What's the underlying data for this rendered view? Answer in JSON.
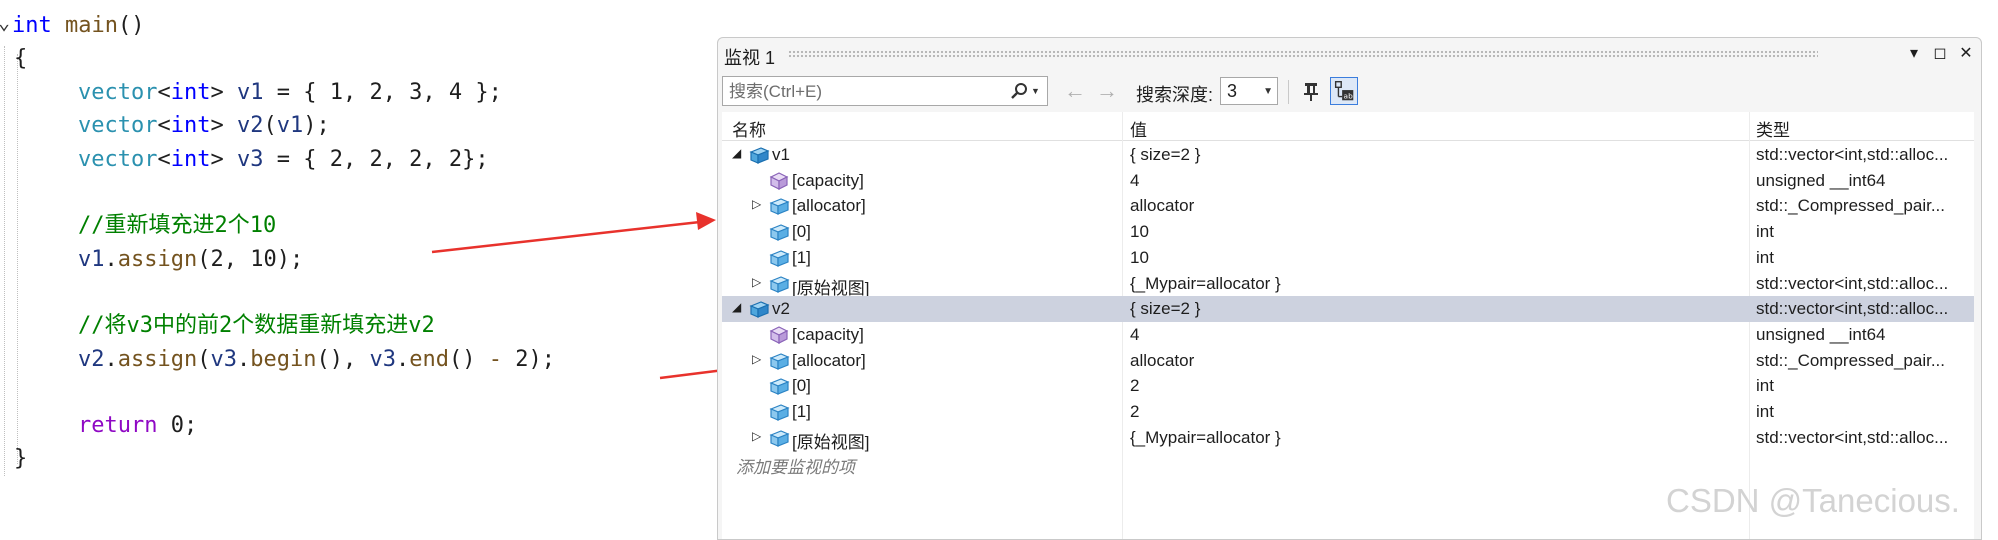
{
  "editor": {
    "lines": [
      [
        "int main()"
      ],
      [
        "{"
      ],
      [
        "vector<int> v1 = { 1, 2, 3, 4 };"
      ],
      [
        "vector<int> v2(v1);"
      ],
      [
        "vector<int> v3 = { 2, 2, 2, 2};"
      ],
      [
        "//重新填充进2个10"
      ],
      [
        "v1.assign(2, 10);"
      ],
      [
        "//将v3中的前2个数据重新填充进v2"
      ],
      [
        "v2.assign(v3.begin(), v3.end() - 2);"
      ],
      [
        "return 0;"
      ],
      [
        "}"
      ]
    ],
    "tokens": {
      "int": "int",
      "main": "main",
      "paren": "()",
      "brace_open": "{",
      "brace_close": "}",
      "vector": "vector",
      "lt": "<",
      "gt": ">",
      "v1": "v1",
      "v2": "v2",
      "v3": "v3",
      "l3_rest": " = { 1, 2, 3, 4 };",
      "l4_a": "(",
      "l4_b": ");",
      "l5_rest": " = { 2, 2, 2, 2};",
      "c1_a": "//重新填充进",
      "c1_b": "2",
      "c1_c": "个",
      "c1_d": "10",
      "assign": "assign",
      "dot": ".",
      "l7_rest": "(2, 10);",
      "c2_a": "//将",
      "c2_b": "v3",
      "c2_c": "中的前",
      "c2_d": "2",
      "c2_e": "个数据重新填充进",
      "c2_f": "v2",
      "l8_a": "(",
      "begin": "begin",
      "l8_b": "(), ",
      "end": "end",
      "l8_c": "() ",
      "minus": "-",
      "l8_d": " 2);",
      "return": "return",
      "l9_rest": " 0;"
    }
  },
  "watch": {
    "title": "监视 1",
    "title_buttons": {
      "dropdown": "▾",
      "maximize": "◻",
      "close": "✕"
    },
    "toolbar": {
      "search_placeholder": "搜索(Ctrl+E)",
      "search_value": "",
      "depth_label": "搜索深度:",
      "depth_value": "3"
    },
    "columns": {
      "name": "名称",
      "value": "值",
      "type": "类型"
    },
    "rows": [
      {
        "name": "v1",
        "value": "{ size=2 }",
        "type": "std::vector<int,std::alloc..."
      },
      {
        "name": "[capacity]",
        "value": "4",
        "type": "unsigned __int64"
      },
      {
        "name": "[allocator]",
        "value": "allocator",
        "type": "std::_Compressed_pair..."
      },
      {
        "name": "[0]",
        "value": "10",
        "type": "int"
      },
      {
        "name": "[1]",
        "value": "10",
        "type": "int"
      },
      {
        "name": "[原始视图]",
        "value": "{_Mypair=allocator }",
        "type": "std::vector<int,std::alloc..."
      },
      {
        "name": "v2",
        "value": "{ size=2 }",
        "type": "std::vector<int,std::alloc..."
      },
      {
        "name": "[capacity]",
        "value": "4",
        "type": "unsigned __int64"
      },
      {
        "name": "[allocator]",
        "value": "allocator",
        "type": "std::_Compressed_pair..."
      },
      {
        "name": "[0]",
        "value": "2",
        "type": "int"
      },
      {
        "name": "[1]",
        "value": "2",
        "type": "int"
      },
      {
        "name": "[原始视图]",
        "value": "{_Mypair=allocator }",
        "type": "std::vector<int,std::alloc..."
      }
    ],
    "add_item_label": "添加要监视的项",
    "expander_icons": {
      "expanded": "◢",
      "collapsed": "▷"
    }
  },
  "watermark": "CSDN @Tanecious.",
  "colors": {
    "keyword": "#0000ff",
    "type": "#2b91af",
    "variable": "#1f377f",
    "function": "#74531f",
    "comment": "#008000",
    "control": "#8f08c4",
    "arrow": "#e8322c",
    "selected_row": "#cdd2df"
  }
}
